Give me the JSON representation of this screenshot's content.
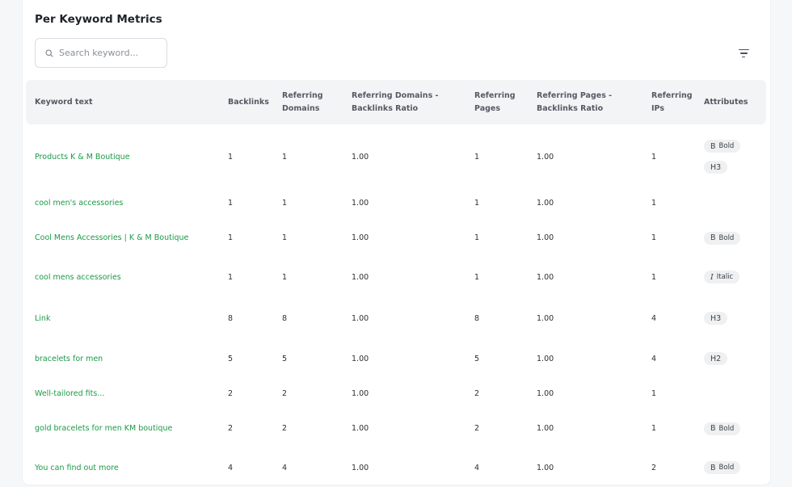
{
  "title": "Per Keyword Metrics",
  "search": {
    "placeholder": "Search keyword...",
    "value": ""
  },
  "columns": [
    {
      "key": "keyword",
      "line1": "Keyword text",
      "line2": ""
    },
    {
      "key": "backlinks",
      "line1": "Backlinks",
      "line2": ""
    },
    {
      "key": "ref_domains",
      "line1": "Referring",
      "line2": "Domains"
    },
    {
      "key": "rd_ratio",
      "line1": "Referring Domains -",
      "line2": "Backlinks Ratio"
    },
    {
      "key": "ref_pages",
      "line1": "Referring",
      "line2": "Pages"
    },
    {
      "key": "rp_ratio",
      "line1": "Referring Pages -",
      "line2": "Backlinks Ratio"
    },
    {
      "key": "ref_ips",
      "line1": "Referring",
      "line2": "IPs"
    },
    {
      "key": "attributes",
      "line1": "Attributes",
      "line2": ""
    }
  ],
  "rows": [
    {
      "keyword": "Products K & M Boutique",
      "backlinks": "1",
      "ref_domains": "1",
      "rd_ratio": "1.00",
      "ref_pages": "1",
      "rp_ratio": "1.00",
      "ref_ips": "1",
      "attributes": [
        {
          "icon": "B",
          "label": "Bold"
        },
        {
          "icon": "H3",
          "label": ""
        }
      ]
    },
    {
      "keyword": "cool men's accessories",
      "backlinks": "1",
      "ref_domains": "1",
      "rd_ratio": "1.00",
      "ref_pages": "1",
      "rp_ratio": "1.00",
      "ref_ips": "1",
      "attributes": []
    },
    {
      "keyword": "Cool Mens Accessories | K & M Boutique",
      "backlinks": "1",
      "ref_domains": "1",
      "rd_ratio": "1.00",
      "ref_pages": "1",
      "rp_ratio": "1.00",
      "ref_ips": "1",
      "attributes": [
        {
          "icon": "B",
          "label": "Bold"
        }
      ]
    },
    {
      "keyword": "cool mens accessories",
      "backlinks": "1",
      "ref_domains": "1",
      "rd_ratio": "1.00",
      "ref_pages": "1",
      "rp_ratio": "1.00",
      "ref_ips": "1",
      "attributes": [
        {
          "icon": "I",
          "label": "Italic"
        }
      ]
    },
    {
      "keyword": "Link",
      "backlinks": "8",
      "ref_domains": "8",
      "rd_ratio": "1.00",
      "ref_pages": "8",
      "rp_ratio": "1.00",
      "ref_ips": "4",
      "attributes": [
        {
          "icon": "H3",
          "label": ""
        }
      ]
    },
    {
      "keyword": "bracelets for men",
      "backlinks": "5",
      "ref_domains": "5",
      "rd_ratio": "1.00",
      "ref_pages": "5",
      "rp_ratio": "1.00",
      "ref_ips": "4",
      "attributes": [
        {
          "icon": "H2",
          "label": ""
        }
      ]
    },
    {
      "keyword": "Well-tailored fits...",
      "backlinks": "2",
      "ref_domains": "2",
      "rd_ratio": "1.00",
      "ref_pages": "2",
      "rp_ratio": "1.00",
      "ref_ips": "1",
      "attributes": []
    },
    {
      "keyword": "gold bracelets for men KM boutique",
      "backlinks": "2",
      "ref_domains": "2",
      "rd_ratio": "1.00",
      "ref_pages": "2",
      "rp_ratio": "1.00",
      "ref_ips": "1",
      "attributes": [
        {
          "icon": "B",
          "label": "Bold"
        }
      ]
    },
    {
      "keyword": "You can find out more",
      "backlinks": "4",
      "ref_domains": "4",
      "rd_ratio": "1.00",
      "ref_pages": "4",
      "rp_ratio": "1.00",
      "ref_ips": "2",
      "attributes": [
        {
          "icon": "B",
          "label": "Bold"
        }
      ]
    }
  ]
}
